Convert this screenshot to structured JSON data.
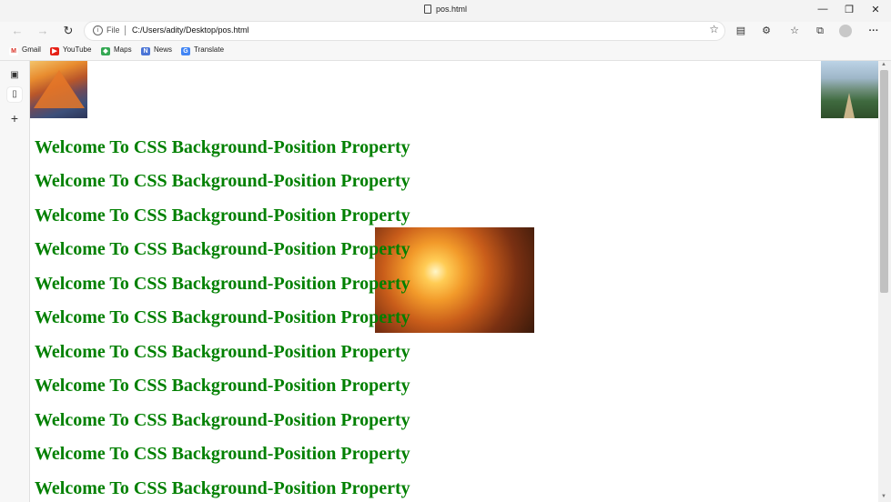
{
  "window": {
    "title": "pos.html",
    "controls": {
      "minimize": "—",
      "maximize": "❐",
      "close": "✕"
    }
  },
  "toolbar": {
    "back_icon": "←",
    "forward_icon": "→",
    "refresh_icon": "↻",
    "address": {
      "scheme_label": "File",
      "url": "C:/Users/adity/Desktop/pos.html"
    },
    "favorite_icon": "☆",
    "right_icons": [
      "reading-mode-icon",
      "extensions-icon",
      "favorites-icon",
      "collections-icon",
      "profile-icon",
      "more-icon"
    ],
    "more_label": "···"
  },
  "bookmarks": [
    {
      "label": "Gmail",
      "icon": "gmail-icon",
      "color": "#d93025",
      "glyph": "M"
    },
    {
      "label": "YouTube",
      "icon": "youtube-icon",
      "color": "#e62117",
      "glyph": "▶"
    },
    {
      "label": "Maps",
      "icon": "maps-icon",
      "color": "#34a853",
      "glyph": "◆"
    },
    {
      "label": "News",
      "icon": "news-icon",
      "color": "#4a74d6",
      "glyph": "N"
    },
    {
      "label": "Translate",
      "icon": "translate-icon",
      "color": "#4285f4",
      "glyph": "G"
    }
  ],
  "sidebar": {
    "tab_icon": "▣",
    "page_icon": "▯",
    "add_icon": "+"
  },
  "page": {
    "heading_text": "Welcome To CSS Background-Position Property",
    "heading_color": "#008000",
    "headings": [
      "Welcome To CSS Background-Position Property",
      "Welcome To CSS Background-Position Property",
      "Welcome To CSS Background-Position Property",
      "Welcome To CSS Background-Position Property",
      "Welcome To CSS Background-Position Property",
      "Welcome To CSS Background-Position Property",
      "Welcome To CSS Background-Position Property",
      "Welcome To CSS Background-Position Property",
      "Welcome To CSS Background-Position Property",
      "Welcome To CSS Background-Position Property",
      "Welcome To CSS Background-Position Property"
    ]
  }
}
